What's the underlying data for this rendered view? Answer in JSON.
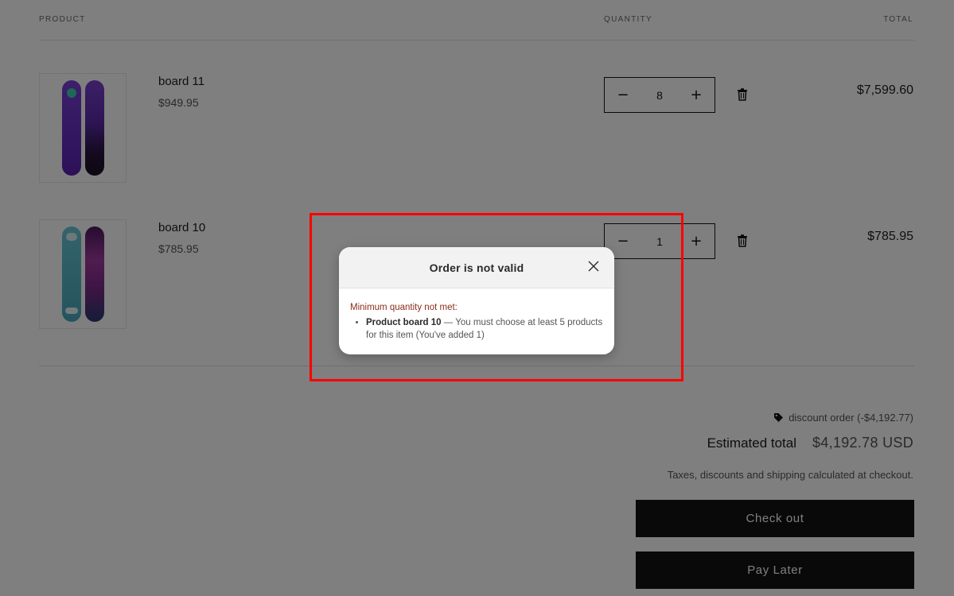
{
  "table_header": {
    "product": "PRODUCT",
    "quantity": "QUANTITY",
    "total": "TOTAL"
  },
  "items": [
    {
      "name": "board 11",
      "price": "$949.95",
      "quantity": "8",
      "total": "$7,599.60",
      "colors": {
        "left": "#6a2fc0",
        "right": "#3a1e6e"
      }
    },
    {
      "name": "board 10",
      "price": "$785.95",
      "quantity": "1",
      "total": "$785.95",
      "colors": {
        "left": "#5fb8c8",
        "right": "#7a2a88"
      }
    }
  ],
  "summary": {
    "discount": "discount order (-$4,192.77)",
    "estimated_label": "Estimated total",
    "estimated_value": "$4,192.78 USD",
    "tax_note": "Taxes, discounts and shipping calculated at checkout.",
    "checkout_label": "Check out",
    "paylater_label": "Pay Later"
  },
  "modal": {
    "title": "Order is not valid",
    "error_heading": "Minimum quantity not met:",
    "error_product": "Product board 10",
    "error_message": " — You must choose at least 5 products for this item (You've added 1)"
  },
  "colors": {
    "highlight": "#ff0000",
    "button": "#121212",
    "error_text": "#8a2e1a"
  }
}
